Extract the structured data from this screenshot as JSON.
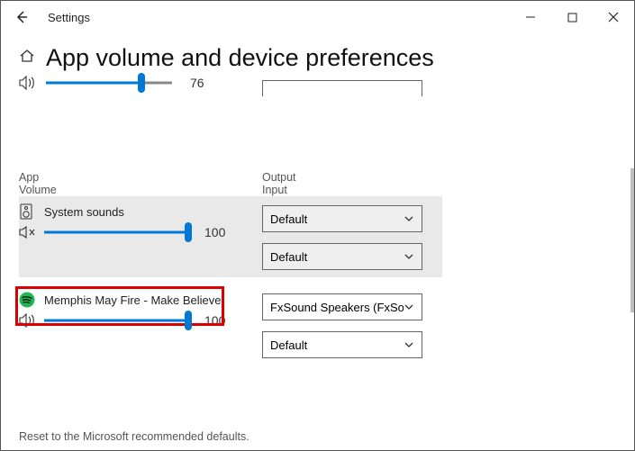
{
  "titlebar": {
    "title": "Settings"
  },
  "header": {
    "title": "App volume and device preferences"
  },
  "master": {
    "volume": 76
  },
  "columns": {
    "app": "App",
    "volume": "Volume",
    "output": "Output",
    "input": "Input"
  },
  "apps": [
    {
      "name": "System sounds",
      "volume": 100,
      "output": "Default",
      "input": "Default"
    },
    {
      "name": "Memphis May Fire - Make Believe",
      "volume": 100,
      "output": "FxSound Speakers (FxSound)",
      "input": "Default"
    }
  ],
  "footer": {
    "reset": "Reset to the Microsoft recommended defaults."
  }
}
